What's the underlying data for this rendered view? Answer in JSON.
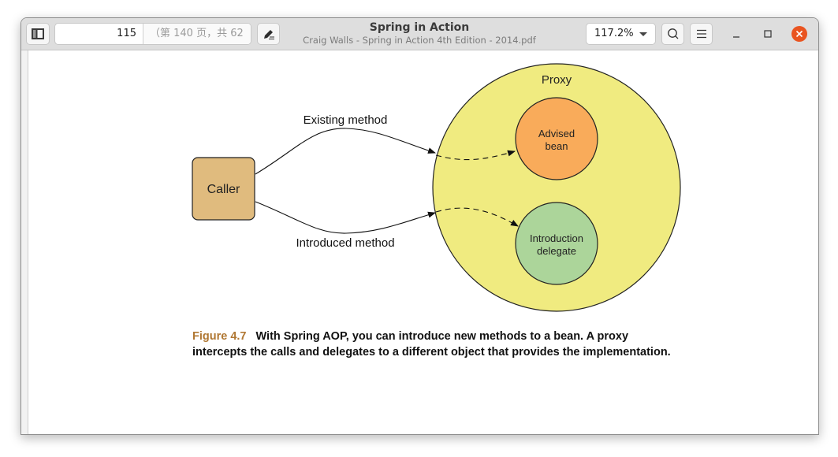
{
  "window": {
    "title": "Spring in Action",
    "subtitle": "Craig Walls - Spring in Action 4th Edition - 2014.pdf"
  },
  "toolbar": {
    "sidebar_toggle_icon": "sidebar-icon",
    "page_number": "115",
    "page_total": "（第 140 页，共 62",
    "annotate_icon": "pencil-icon",
    "zoom_level": "117.2%",
    "search_icon": "search-icon",
    "menu_icon": "hamburger-icon",
    "minimize_icon": "minimize-icon",
    "maximize_icon": "maximize-icon",
    "close_icon": "close-icon",
    "close_color": "#e95420"
  },
  "figure": {
    "caller_label": "Caller",
    "proxy_label": "Proxy",
    "advised_bean_label_line1": "Advised",
    "advised_bean_label_line2": "bean",
    "delegate_label_line1": "Introduction",
    "delegate_label_line2": "delegate",
    "existing_method_label": "Existing method",
    "introduced_method_label": "Introduced method",
    "colors": {
      "caller": "#e0bb7e",
      "proxy": "#f0eb80",
      "advised_bean": "#f9ab5a",
      "delegate": "#acd59a"
    }
  },
  "caption": {
    "label": "Figure 4.7",
    "line1": "With Spring AOP, you can introduce new methods to a bean. A proxy",
    "line2": "intercepts the calls and delegates to a different object that provides the implementation."
  }
}
